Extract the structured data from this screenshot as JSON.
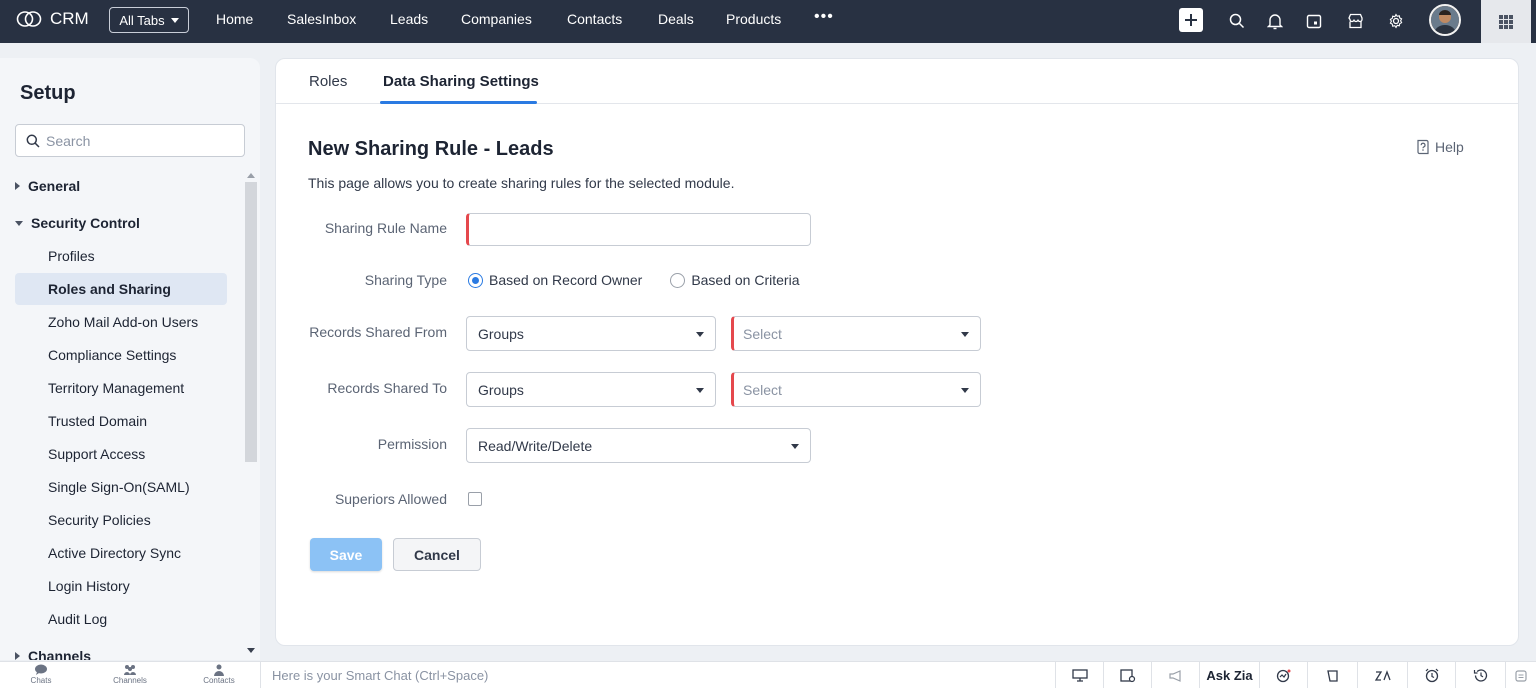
{
  "topbar": {
    "brand": "CRM",
    "all_tabs": "All Tabs",
    "nav": [
      "Home",
      "SalesInbox",
      "Leads",
      "Companies",
      "Contacts",
      "Deals",
      "Products"
    ],
    "more": "•••",
    "icons": [
      "plus-icon",
      "search-icon",
      "bell-icon",
      "calendar-icon",
      "marketplace-icon",
      "gear-icon",
      "avatar",
      "apps-grid-icon"
    ]
  },
  "sidebar": {
    "title": "Setup",
    "search_placeholder": "Search",
    "groups": {
      "general": "General",
      "security": "Security Control",
      "channels": "Channels"
    },
    "items": [
      "Profiles",
      "Roles and Sharing",
      "Zoho Mail Add-on Users",
      "Compliance Settings",
      "Territory Management",
      "Trusted Domain",
      "Support Access",
      "Single Sign-On(SAML)",
      "Security Policies",
      "Active Directory Sync",
      "Login History",
      "Audit Log"
    ],
    "active_item": "Roles and Sharing"
  },
  "main": {
    "tabs": [
      "Roles",
      "Data Sharing Settings"
    ],
    "active_tab": "Data Sharing Settings",
    "help": "Help",
    "title": "New Sharing Rule - Leads",
    "description": "This page allows you to create sharing rules for the selected module.",
    "form": {
      "rule_name_label": "Sharing Rule Name",
      "rule_name_value": "",
      "sharing_type_label": "Sharing Type",
      "sharing_type_options": [
        "Based on Record Owner",
        "Based on Criteria"
      ],
      "sharing_type_selected": "Based on Record Owner",
      "shared_from_label": "Records Shared From",
      "shared_from_type": "Groups",
      "shared_from_value": "Select",
      "shared_to_label": "Records Shared To",
      "shared_to_type": "Groups",
      "shared_to_value": "Select",
      "permission_label": "Permission",
      "permission_value": "Read/Write/Delete",
      "superiors_label": "Superiors Allowed",
      "superiors_checked": false,
      "save": "Save",
      "cancel": "Cancel"
    }
  },
  "bottombar": {
    "left": [
      "Chats",
      "Channels",
      "Contacts"
    ],
    "smart_chat_placeholder": "Here is your Smart Chat (Ctrl+Space)",
    "ask_zia": "Ask Zia"
  },
  "colors": {
    "topbar": "#283142",
    "accent": "#2a7ae2",
    "required": "#e5484d",
    "save_disabled": "#8cc2f5"
  }
}
